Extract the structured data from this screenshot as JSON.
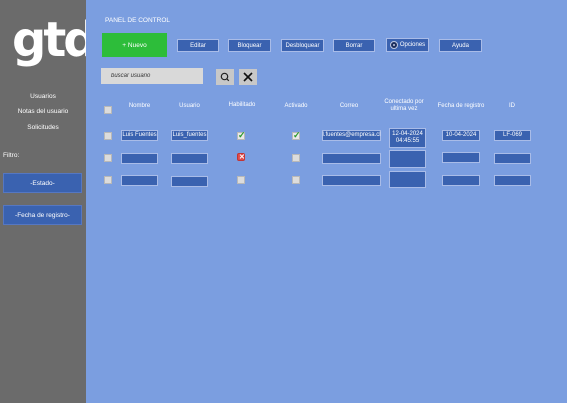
{
  "logo": "gtd",
  "sidebar": {
    "links": [
      "Usuarios",
      "Notas del usuario",
      "Solicitudes"
    ],
    "filter_label": "Filtro:",
    "filters": [
      "-Estado-",
      "-Fecha de registro-"
    ]
  },
  "panel_title": "PANEL DE CONTROL",
  "toolbar": {
    "nuevo": "+ Nuevo",
    "editar": "Editar",
    "bloquear": "Bloquear",
    "desbloquear": "Desbloquear",
    "borrar": "Borrar",
    "opciones": "Opciones",
    "ayuda": "Ayuda"
  },
  "search": {
    "placeholder": "buscar usuario"
  },
  "table": {
    "headers": {
      "nombre": "Nombre",
      "usuario": "Usuario",
      "habilitado": "Habilitado",
      "activado": "Activado",
      "correo": "Correo",
      "conectado_1": "Conectado por",
      "conectado_2": "ultima vez",
      "fecha": "Fecha de registro",
      "id": "ID"
    },
    "rows": [
      {
        "nombre": "Luis Fuentes",
        "usuario": "Luis_fuentes",
        "habilitado": true,
        "activado": true,
        "correo": "l.fuentes@empresa.cl",
        "conectado_fecha": "12-04-2024",
        "conectado_hora": "04:45:55",
        "fecha": "10-04-2024",
        "id": "LF-069"
      },
      {
        "nombre": "",
        "usuario": "",
        "habilitado": "x",
        "activado": false,
        "correo": "",
        "conectado_fecha": "",
        "conectado_hora": "",
        "fecha": "",
        "id": ""
      },
      {
        "nombre": "",
        "usuario": "",
        "habilitado": false,
        "activado": false,
        "correo": "",
        "conectado_fecha": "",
        "conectado_hora": "",
        "fecha": "",
        "id": ""
      }
    ]
  }
}
